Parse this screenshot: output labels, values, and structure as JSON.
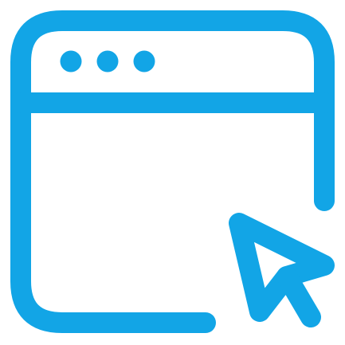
{
  "icon": {
    "name": "browser-window-click-icon",
    "color": "#12A5E6",
    "background": "#FFFFFF"
  }
}
